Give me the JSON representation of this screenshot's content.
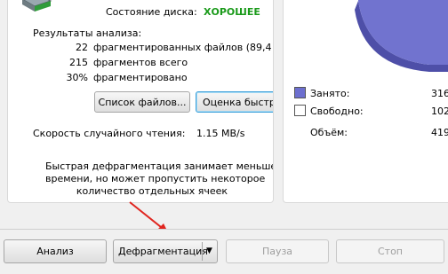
{
  "disk_state": {
    "label": "Состояние диска:",
    "value": "ХОРОШЕЕ"
  },
  "analysis": {
    "title": "Результаты анализа:",
    "rows": [
      {
        "value": "22",
        "text": "фрагментированных файлов (89,4 Г"
      },
      {
        "value": "215",
        "text": "фрагментов всего"
      },
      {
        "value": "30%",
        "text": "фрагментировано"
      }
    ]
  },
  "buttons": {
    "file_list": "Список файлов...",
    "estimate": "Оценка быстр",
    "analyze": "Анализ",
    "defrag": "Дефрагментация",
    "pause": "Пауза",
    "stop": "Стоп"
  },
  "read_speed": {
    "label": "Скорость случайного чтения:",
    "value": "1.15 MB/s"
  },
  "info_text": [
    "Быстрая дефрагментация занимает меньше",
    "времени, но может пропустить некоторое",
    "количество отдельных ячеек"
  ],
  "legend": {
    "used": {
      "label": "Занято:",
      "value": "316",
      "color": "#6d6fcf"
    },
    "free": {
      "label": "Свободно:",
      "value": "102",
      "color": "#ffffff"
    },
    "total": {
      "label": "Объём:",
      "value": "419"
    }
  },
  "colors": {
    "pie_fill": "#7173cf",
    "pie_side": "#4e4fa8",
    "arrow": "#e0251f"
  }
}
